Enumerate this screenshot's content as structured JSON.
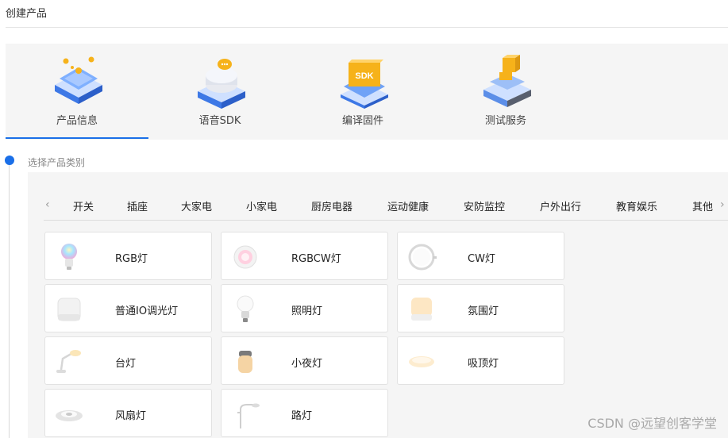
{
  "page": {
    "title": "创建产品"
  },
  "steps": [
    {
      "label": "产品信息",
      "icon": "product-info-icon",
      "active": true
    },
    {
      "label": "语音SDK",
      "icon": "voice-sdk-icon",
      "active": false
    },
    {
      "label": "编译固件",
      "icon": "compile-firmware-icon",
      "active": false
    },
    {
      "label": "测试服务",
      "icon": "test-service-icon",
      "active": false
    }
  ],
  "colors": {
    "accent": "#1a6fe8",
    "panel": "#f5f5f5"
  },
  "category_section": {
    "label": "选择产品类别",
    "tabs": [
      "开关",
      "插座",
      "大家电",
      "小家电",
      "厨房电器",
      "运动健康",
      "安防监控",
      "户外出行",
      "教育娱乐",
      "其他"
    ],
    "prev_arrow": "‹",
    "next_arrow": "›"
  },
  "products": [
    {
      "label": "RGB灯",
      "icon": "rgb-bulb-icon"
    },
    {
      "label": "RGBCW灯",
      "icon": "rgbcw-lamp-icon"
    },
    {
      "label": "CW灯",
      "icon": "cw-ring-lamp-icon"
    },
    {
      "label": "普通IO调光灯",
      "icon": "io-dimmer-lamp-icon"
    },
    {
      "label": "照明灯",
      "icon": "lighting-bulb-icon"
    },
    {
      "label": "氛围灯",
      "icon": "ambient-lamp-icon"
    },
    {
      "label": "台灯",
      "icon": "desk-lamp-icon"
    },
    {
      "label": "小夜灯",
      "icon": "night-light-icon"
    },
    {
      "label": "吸顶灯",
      "icon": "ceiling-lamp-icon"
    },
    {
      "label": "风扇灯",
      "icon": "fan-lamp-icon"
    },
    {
      "label": "路灯",
      "icon": "street-lamp-icon"
    }
  ],
  "watermark": "CSDN @远望创客学堂"
}
